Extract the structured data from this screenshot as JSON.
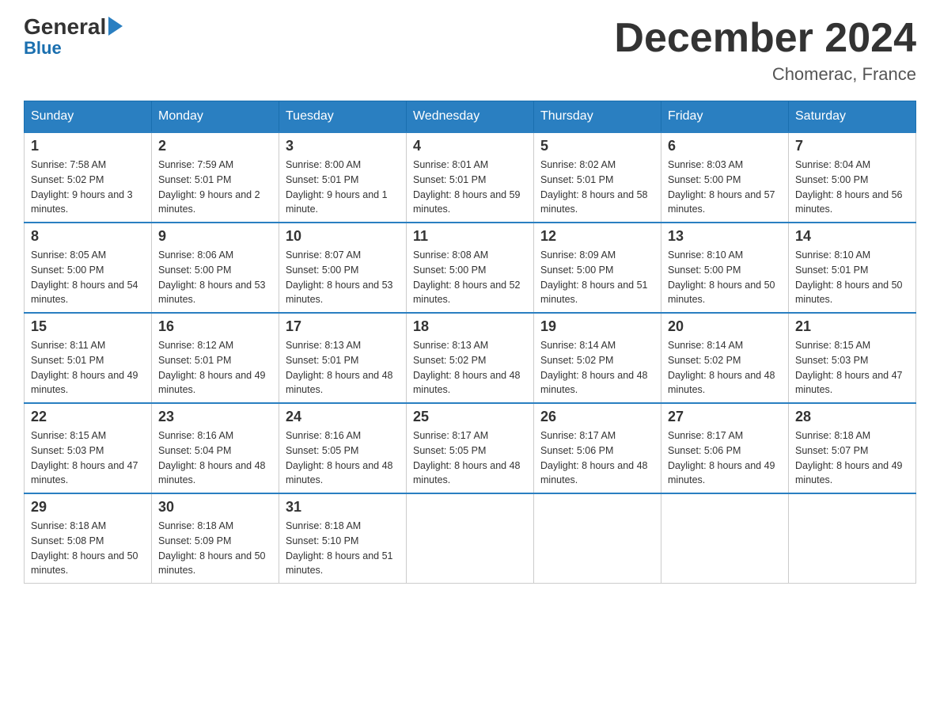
{
  "header": {
    "logo_general": "General",
    "logo_blue": "Blue",
    "month_title": "December 2024",
    "location": "Chomerac, France"
  },
  "days_of_week": [
    "Sunday",
    "Monday",
    "Tuesday",
    "Wednesday",
    "Thursday",
    "Friday",
    "Saturday"
  ],
  "weeks": [
    [
      {
        "day": "1",
        "sunrise": "7:58 AM",
        "sunset": "5:02 PM",
        "daylight": "9 hours and 3 minutes."
      },
      {
        "day": "2",
        "sunrise": "7:59 AM",
        "sunset": "5:01 PM",
        "daylight": "9 hours and 2 minutes."
      },
      {
        "day": "3",
        "sunrise": "8:00 AM",
        "sunset": "5:01 PM",
        "daylight": "9 hours and 1 minute."
      },
      {
        "day": "4",
        "sunrise": "8:01 AM",
        "sunset": "5:01 PM",
        "daylight": "8 hours and 59 minutes."
      },
      {
        "day": "5",
        "sunrise": "8:02 AM",
        "sunset": "5:01 PM",
        "daylight": "8 hours and 58 minutes."
      },
      {
        "day": "6",
        "sunrise": "8:03 AM",
        "sunset": "5:00 PM",
        "daylight": "8 hours and 57 minutes."
      },
      {
        "day": "7",
        "sunrise": "8:04 AM",
        "sunset": "5:00 PM",
        "daylight": "8 hours and 56 minutes."
      }
    ],
    [
      {
        "day": "8",
        "sunrise": "8:05 AM",
        "sunset": "5:00 PM",
        "daylight": "8 hours and 54 minutes."
      },
      {
        "day": "9",
        "sunrise": "8:06 AM",
        "sunset": "5:00 PM",
        "daylight": "8 hours and 53 minutes."
      },
      {
        "day": "10",
        "sunrise": "8:07 AM",
        "sunset": "5:00 PM",
        "daylight": "8 hours and 53 minutes."
      },
      {
        "day": "11",
        "sunrise": "8:08 AM",
        "sunset": "5:00 PM",
        "daylight": "8 hours and 52 minutes."
      },
      {
        "day": "12",
        "sunrise": "8:09 AM",
        "sunset": "5:00 PM",
        "daylight": "8 hours and 51 minutes."
      },
      {
        "day": "13",
        "sunrise": "8:10 AM",
        "sunset": "5:00 PM",
        "daylight": "8 hours and 50 minutes."
      },
      {
        "day": "14",
        "sunrise": "8:10 AM",
        "sunset": "5:01 PM",
        "daylight": "8 hours and 50 minutes."
      }
    ],
    [
      {
        "day": "15",
        "sunrise": "8:11 AM",
        "sunset": "5:01 PM",
        "daylight": "8 hours and 49 minutes."
      },
      {
        "day": "16",
        "sunrise": "8:12 AM",
        "sunset": "5:01 PM",
        "daylight": "8 hours and 49 minutes."
      },
      {
        "day": "17",
        "sunrise": "8:13 AM",
        "sunset": "5:01 PM",
        "daylight": "8 hours and 48 minutes."
      },
      {
        "day": "18",
        "sunrise": "8:13 AM",
        "sunset": "5:02 PM",
        "daylight": "8 hours and 48 minutes."
      },
      {
        "day": "19",
        "sunrise": "8:14 AM",
        "sunset": "5:02 PM",
        "daylight": "8 hours and 48 minutes."
      },
      {
        "day": "20",
        "sunrise": "8:14 AM",
        "sunset": "5:02 PM",
        "daylight": "8 hours and 48 minutes."
      },
      {
        "day": "21",
        "sunrise": "8:15 AM",
        "sunset": "5:03 PM",
        "daylight": "8 hours and 47 minutes."
      }
    ],
    [
      {
        "day": "22",
        "sunrise": "8:15 AM",
        "sunset": "5:03 PM",
        "daylight": "8 hours and 47 minutes."
      },
      {
        "day": "23",
        "sunrise": "8:16 AM",
        "sunset": "5:04 PM",
        "daylight": "8 hours and 48 minutes."
      },
      {
        "day": "24",
        "sunrise": "8:16 AM",
        "sunset": "5:05 PM",
        "daylight": "8 hours and 48 minutes."
      },
      {
        "day": "25",
        "sunrise": "8:17 AM",
        "sunset": "5:05 PM",
        "daylight": "8 hours and 48 minutes."
      },
      {
        "day": "26",
        "sunrise": "8:17 AM",
        "sunset": "5:06 PM",
        "daylight": "8 hours and 48 minutes."
      },
      {
        "day": "27",
        "sunrise": "8:17 AM",
        "sunset": "5:06 PM",
        "daylight": "8 hours and 49 minutes."
      },
      {
        "day": "28",
        "sunrise": "8:18 AM",
        "sunset": "5:07 PM",
        "daylight": "8 hours and 49 minutes."
      }
    ],
    [
      {
        "day": "29",
        "sunrise": "8:18 AM",
        "sunset": "5:08 PM",
        "daylight": "8 hours and 50 minutes."
      },
      {
        "day": "30",
        "sunrise": "8:18 AM",
        "sunset": "5:09 PM",
        "daylight": "8 hours and 50 minutes."
      },
      {
        "day": "31",
        "sunrise": "8:18 AM",
        "sunset": "5:10 PM",
        "daylight": "8 hours and 51 minutes."
      },
      null,
      null,
      null,
      null
    ]
  ]
}
